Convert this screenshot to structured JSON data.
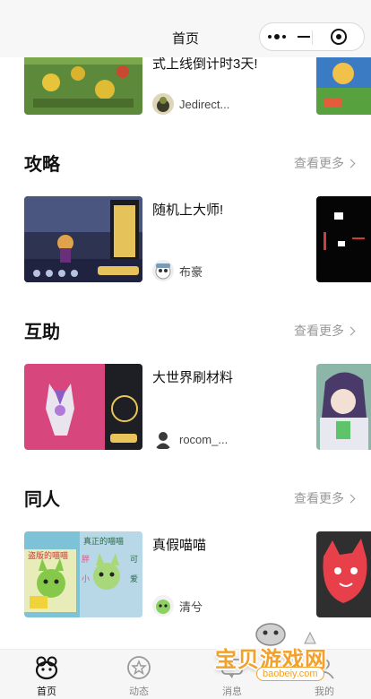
{
  "header": {
    "title": "首页"
  },
  "capsule": {
    "more_icon": "more-dots-icon",
    "minimize_icon": "minimize-icon",
    "close_icon": "target-close-icon"
  },
  "top_card": {
    "title": "式上线倒计时3天!",
    "author": "Jedirect..."
  },
  "sections": [
    {
      "title": "攻略",
      "more": "查看更多",
      "card": {
        "title": "随机上大师!",
        "author": "布豪"
      }
    },
    {
      "title": "互助",
      "more": "查看更多",
      "card": {
        "title": "大世界刷材料",
        "author": "rocom_..."
      }
    },
    {
      "title": "同人",
      "more": "查看更多",
      "card": {
        "title": "真假喵喵",
        "author": "清兮"
      }
    }
  ],
  "thumb_text": {
    "fanart_left": "盗版的喵喵",
    "fanart_top": "真正的喵喵",
    "fanart_side1": "胖",
    "fanart_side2": "小",
    "fanart_side3": "可",
    "fanart_side4": "爱"
  },
  "tabs": [
    {
      "label": "首页",
      "icon": "home-icon",
      "active": true
    },
    {
      "label": "动态",
      "icon": "star-circle-icon",
      "active": false
    },
    {
      "label": "消息",
      "icon": "message-icon",
      "active": false
    },
    {
      "label": "我的",
      "icon": "profile-icon",
      "active": false
    }
  ],
  "watermark": {
    "text": "宝贝游戏网",
    "url": "baobeiy.com"
  },
  "colors": {
    "highlight": "#fbd862",
    "watermark": "#f2a12a",
    "more_text": "#999999"
  }
}
